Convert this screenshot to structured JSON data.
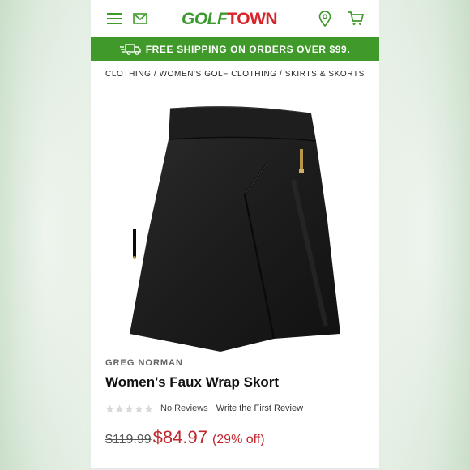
{
  "header": {
    "logo_part1": "GOLF",
    "logo_part2": "TOWN",
    "icons": [
      "menu-icon",
      "mail-icon",
      "location-icon",
      "cart-icon"
    ]
  },
  "promo": {
    "text": "FREE SHIPPING ON ORDERS OVER $99."
  },
  "breadcrumb": {
    "text": "CLOTHING / WOMEN'S GOLF CLOTHING / SKIRTS & SKORTS"
  },
  "product": {
    "brand": "GREG NORMAN",
    "title": "Women's Faux Wrap Skort",
    "rating_stars": 0,
    "reviews_label": "No Reviews",
    "write_review_label": "Write the First Review",
    "old_price": "$119.99",
    "new_price": "$84.97",
    "discount": "(29% off)"
  },
  "colors": {
    "brand_green": "#3f9a2a",
    "brand_red": "#d8232a",
    "sale_red": "#c0262d"
  }
}
